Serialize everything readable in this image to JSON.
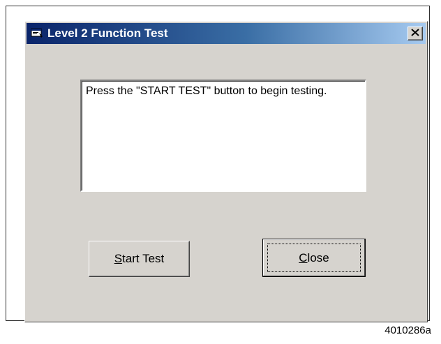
{
  "window": {
    "title": "Level 2 Function Test",
    "icon": "window-app-icon",
    "close_icon": "close-x-icon"
  },
  "message": {
    "text": "Press the \"START TEST\" button to begin testing."
  },
  "buttons": {
    "start_mnemonic": "S",
    "start_rest": "tart Test",
    "close_mnemonic": "C",
    "close_rest": "lose"
  },
  "figure_id": "4010286a",
  "colors": {
    "title_gradient_start": "#0a246a",
    "title_gradient_end": "#a6caf0",
    "dialog_face": "#d6d3ce",
    "text_box": "#ffffff"
  }
}
